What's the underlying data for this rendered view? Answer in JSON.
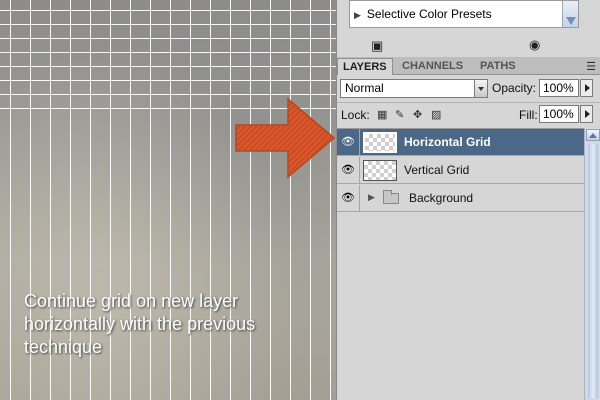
{
  "canvas": {
    "caption": "Continue grid on new layer horizontally with the previous technique"
  },
  "actions_panel": {
    "item_label": "Selective Color Presets",
    "tool_icons": [
      "new-set-icon",
      "record-icon"
    ]
  },
  "layers_panel": {
    "tabs": [
      {
        "label": "LAYERS",
        "active": true
      },
      {
        "label": "CHANNELS",
        "active": false
      },
      {
        "label": "PATHS",
        "active": false
      }
    ],
    "blend_mode": "Normal",
    "opacity_label": "Opacity:",
    "opacity_value": "100%",
    "lock_label": "Lock:",
    "fill_label": "Fill:",
    "fill_value": "100%",
    "layers": [
      {
        "name": "Horizontal Grid",
        "selected": true,
        "visible": true,
        "type": "pixel"
      },
      {
        "name": "Vertical Grid",
        "selected": false,
        "visible": true,
        "type": "pixel"
      },
      {
        "name": "Background",
        "selected": false,
        "visible": true,
        "type": "group"
      }
    ]
  },
  "colors": {
    "arrow": "#d9572b",
    "selected_layer": "#4b6886",
    "panel_bg": "#d6d6d6"
  }
}
